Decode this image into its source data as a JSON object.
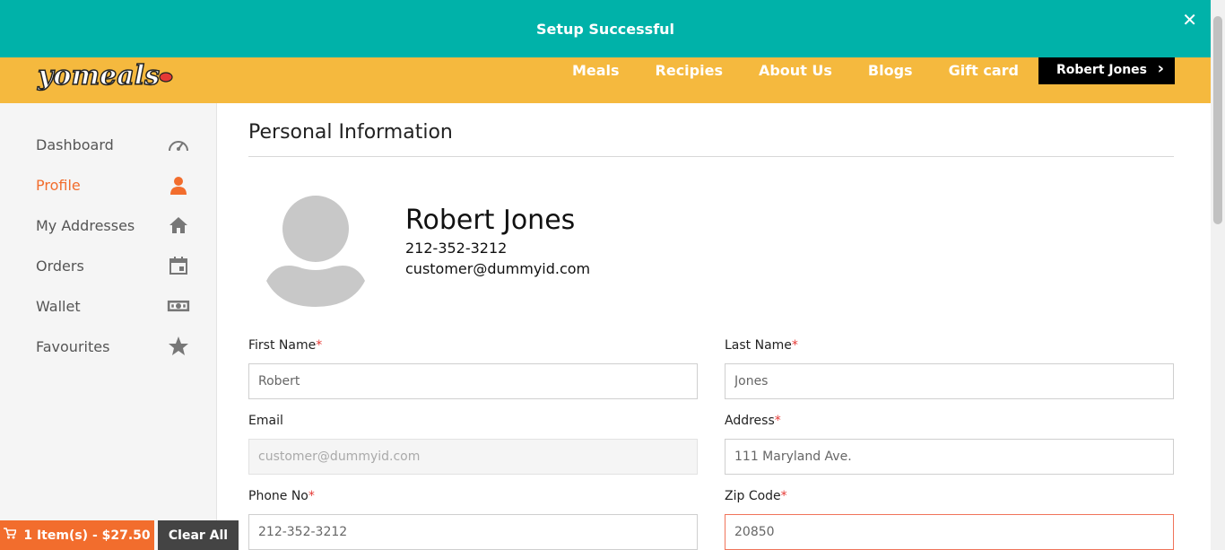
{
  "toast": {
    "message": "Setup Successful",
    "close_icon": "close-icon"
  },
  "header": {
    "logo_text": "yomeals",
    "nav": [
      "Meals",
      "Recipies",
      "About Us",
      "Blogs",
      "Gift card"
    ],
    "user_button": "Robert Jones"
  },
  "sidebar": {
    "items": [
      {
        "label": "Dashboard",
        "icon": "speedometer-icon"
      },
      {
        "label": "Profile",
        "icon": "person-icon"
      },
      {
        "label": "My Addresses",
        "icon": "home-icon"
      },
      {
        "label": "Orders",
        "icon": "calendar-icon"
      },
      {
        "label": "Wallet",
        "icon": "money-icon"
      },
      {
        "label": "Favourites",
        "icon": "star-icon"
      }
    ]
  },
  "main": {
    "title": "Personal Information",
    "profile": {
      "name": "Robert Jones",
      "phone": "212-352-3212",
      "email": "customer@dummyid.com"
    },
    "form": {
      "first_name_label": "First Name",
      "first_name": "Robert",
      "last_name_label": "Last Name",
      "last_name": "Jones",
      "email_label": "Email",
      "email": "customer@dummyid.com",
      "address_label": "Address",
      "address": "111 Maryland Ave.",
      "phone_label": "Phone No",
      "phone": "212-352-3212",
      "zip_label": "Zip Code",
      "zip": "20850",
      "required_mark": "*"
    }
  },
  "cart": {
    "summary": "1 Item(s) - $27.50",
    "clear": "Clear All"
  },
  "colors": {
    "teal": "#00b2a9",
    "yellow": "#f5b93e",
    "orange": "#f26d2d"
  }
}
